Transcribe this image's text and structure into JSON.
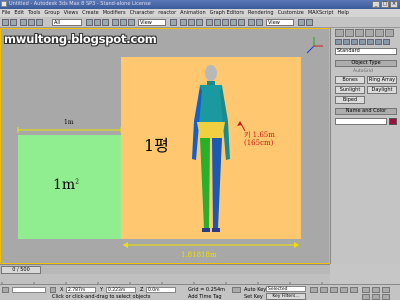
{
  "titlebar": {
    "title": "Untitled - Autodesk 3ds Max 8 SP3 - Stand-alone License",
    "min": "_",
    "max": "□",
    "close": "×"
  },
  "menubar": {
    "items": [
      "File",
      "Edit",
      "Tools",
      "Group",
      "Views",
      "Create",
      "Modifiers",
      "Character",
      "reactor",
      "Animation",
      "Graph Editors",
      "Rendering",
      "Customize",
      "MAXScript",
      "Help"
    ]
  },
  "toolbar": {
    "filter_select": "All",
    "view_select": "View",
    "view_select2": "View"
  },
  "viewport": {
    "watermark": "mwultong.blogspot.com",
    "label_1m": "1m",
    "label_1m2_base": "1m",
    "label_1m2_sup": "2",
    "label_pyeong": "1평",
    "height_line1": "키 1.65m",
    "height_line2": "(165cm)",
    "label_width": "1.81818m",
    "colors": {
      "green": "#90ee90",
      "orange": "#ffc870",
      "annotation_red": "#c81818",
      "measure_yellow": "#f0e000",
      "viewport_border": "#f0c000"
    }
  },
  "rightpanel": {
    "dropdown": "Standard",
    "rollup_object_type": "Object Type",
    "autogrid": "AutoGrid",
    "buttons": [
      "Bones",
      "Ring Array",
      "Sunlight",
      "Daylight",
      "Biped"
    ],
    "rollup_name_color": "Name and Color"
  },
  "timeline": {
    "slider": "0 / 500"
  },
  "statusbar": {
    "x_value": "2.787m",
    "y_value": "0.223m",
    "z_value": "0.0m",
    "grid": "Grid = 0.254m",
    "autokey": "Auto Key",
    "selected": "Selected",
    "setkey": "Set Key",
    "keyfilters": "Key Filters...",
    "prompt": "Click or click-and-drag to select objects",
    "add_time_tag": "Add Time Tag"
  }
}
